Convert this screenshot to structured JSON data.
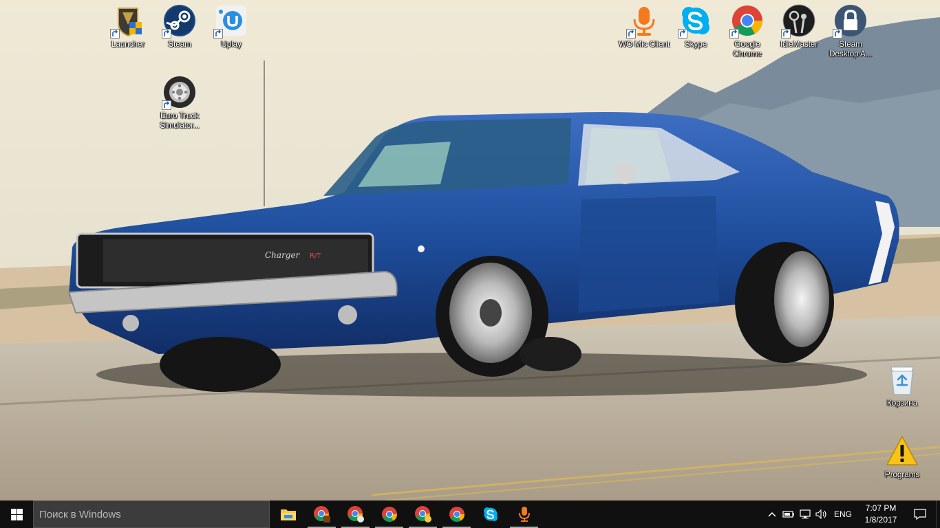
{
  "desktop": {
    "icons": [
      {
        "label": "Launcher",
        "icon": "launcher-shield-icon"
      },
      {
        "label": "Steam",
        "icon": "steam-icon"
      },
      {
        "label": "Uplay",
        "icon": "uplay-icon"
      },
      {
        "label": "Euro Truck Simulator...",
        "icon": "euro-truck-simulator-icon"
      },
      {
        "label": "WO Mic Client",
        "icon": "microphone-icon"
      },
      {
        "label": "Skype",
        "icon": "skype-icon"
      },
      {
        "label": "Google Chrome",
        "icon": "chrome-icon"
      },
      {
        "label": "IdleMaster",
        "icon": "idlemaster-icon"
      },
      {
        "label": "Steam Desktop A...",
        "icon": "steam-desktop-authenticator-icon"
      },
      {
        "label": "Корзина",
        "icon": "recycle-bin-icon"
      },
      {
        "label": "Programs",
        "icon": "warning-icon"
      }
    ],
    "wallpaper": {
      "subject": "blue Dodge Charger R/T",
      "grille_badge": "Charger",
      "badge_rt": "R/T"
    }
  },
  "taskbar": {
    "search_placeholder": "Поиск в Windows",
    "apps": [
      {
        "icon": "file-explorer-icon"
      },
      {
        "icon": "chrome-profile-1-icon"
      },
      {
        "icon": "chrome-profile-2-icon"
      },
      {
        "icon": "chrome-icon"
      },
      {
        "icon": "chrome-profile-3-icon"
      },
      {
        "icon": "chrome-icon"
      },
      {
        "icon": "skype-icon"
      },
      {
        "icon": "microphone-icon"
      }
    ],
    "tray": {
      "language": "ENG",
      "time": "7:07 PM",
      "date": "1/8/2017"
    }
  },
  "colors": {
    "taskbar_bg": "#101010",
    "search_bg": "#3c3c3c",
    "steam_blue": "#1b4e8c",
    "skype_blue": "#00aff0",
    "mic_orange": "#f47a1e",
    "warning_yellow": "#f7c316",
    "car_blue": "#1f4f9e"
  }
}
